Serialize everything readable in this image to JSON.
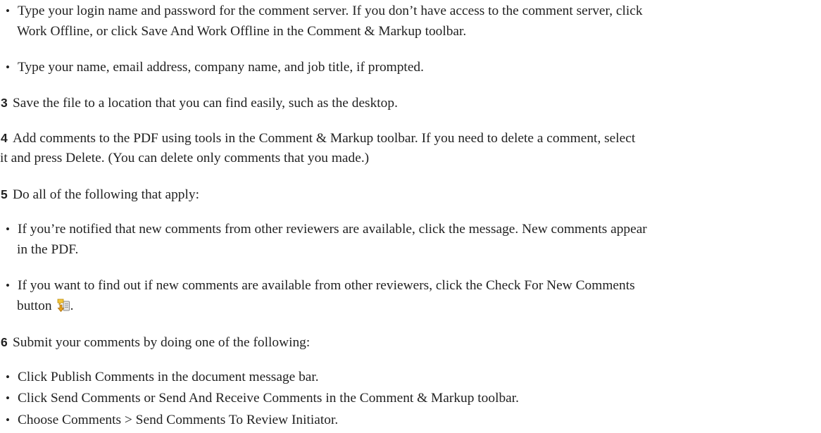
{
  "document": {
    "bullet_char": "•",
    "login": {
      "line1": "Type your login name and password for the comment server. If you don’t have access to the comment server, click",
      "line2": "Work Offline, or click Save And Work Offline in the Comment & Markup toolbar."
    },
    "prompted": "Type your name, email address, company name, and job title, if prompted.",
    "step3": {
      "number": "3",
      "text": "Save the file to a location that you can find easily, such as the desktop."
    },
    "step4": {
      "number": "4",
      "line1": "Add comments to the PDF using tools in the Comment & Markup toolbar. If you need to delete a comment, select",
      "line2": "it and press Delete. (You can delete only comments that you made.)"
    },
    "step5": {
      "number": "5",
      "text": "Do all of the following that apply:"
    },
    "notified": {
      "line1": "If you’re notified that new comments from other reviewers are available, click the message. New comments appear",
      "line2": "in the PDF."
    },
    "check_new": {
      "line1": "If you want to find out if new comments are available from other reviewers, click the Check For New Comments",
      "line2_before_icon": "button",
      "line2_after_icon": ".",
      "icon": "check-for-new-comments-icon"
    },
    "step6": {
      "number": "6",
      "text": "Submit your comments by doing one of the following:"
    },
    "publish": "Click Publish Comments in the document message bar.",
    "send": "Click Send Comments or Send And Receive Comments in the Comment & Markup toolbar.",
    "choose": "Choose Comments > Send Comments To Review Initiator."
  }
}
